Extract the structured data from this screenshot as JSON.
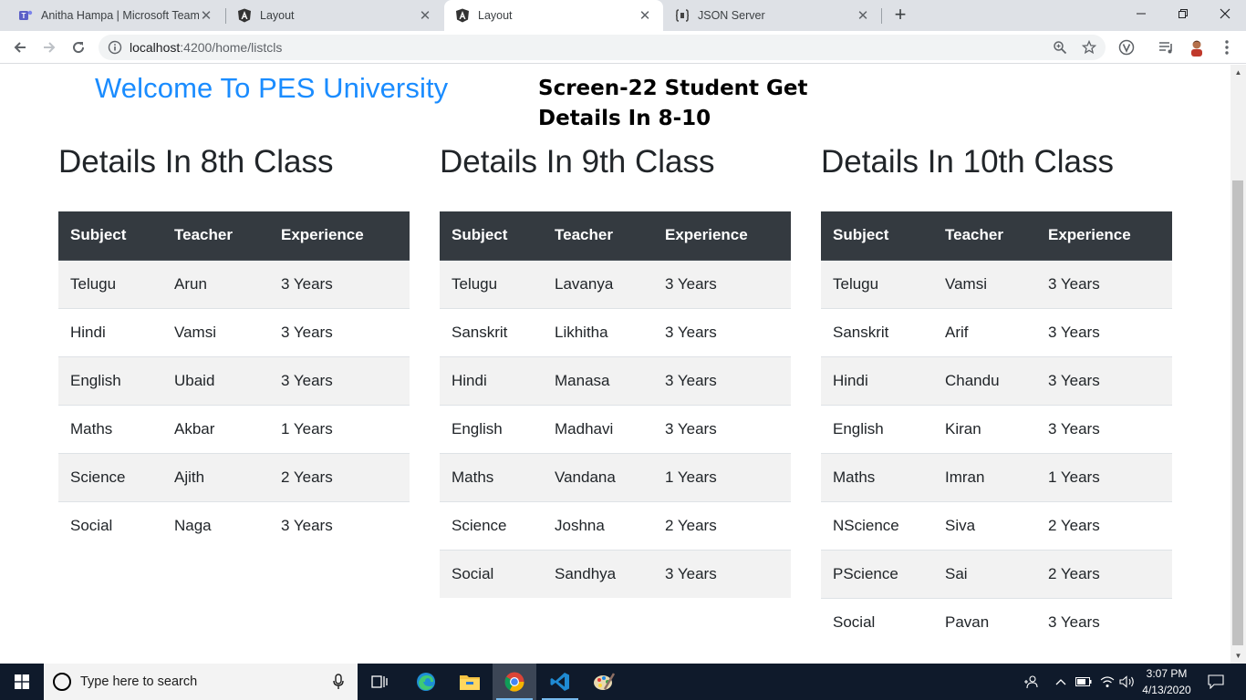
{
  "browser": {
    "tabs": [
      {
        "title": "Anitha Hampa | Microsoft Teams",
        "icon": "teams-icon"
      },
      {
        "title": "Layout",
        "icon": "angular-icon"
      },
      {
        "title": "Layout",
        "icon": "angular-icon"
      },
      {
        "title": "JSON Server",
        "icon": "json-server-icon"
      }
    ],
    "active_tab": 2,
    "url_host": "localhost",
    "url_path": ":4200/home/listcls"
  },
  "page": {
    "welcome": "Welcome To PES University",
    "screen_title": "Screen-22 Student Get Details In 8-10",
    "columns": [
      "Subject",
      "Teacher",
      "Experience"
    ],
    "classes": [
      {
        "heading": "Details In 8th Class",
        "rows": [
          [
            "Telugu",
            "Arun",
            "3 Years"
          ],
          [
            "Hindi",
            "Vamsi",
            "3 Years"
          ],
          [
            "English",
            "Ubaid",
            "3 Years"
          ],
          [
            "Maths",
            "Akbar",
            "1 Years"
          ],
          [
            "Science",
            "Ajith",
            "2 Years"
          ],
          [
            "Social",
            "Naga",
            "3 Years"
          ]
        ]
      },
      {
        "heading": "Details In 9th Class",
        "rows": [
          [
            "Telugu",
            "Lavanya",
            "3 Years"
          ],
          [
            "Sanskrit",
            "Likhitha",
            "3 Years"
          ],
          [
            "Hindi",
            "Manasa",
            "3 Years"
          ],
          [
            "English",
            "Madhavi",
            "3 Years"
          ],
          [
            "Maths",
            "Vandana",
            "1 Years"
          ],
          [
            "Science",
            "Joshna",
            "2 Years"
          ],
          [
            "Social",
            "Sandhya",
            "3 Years"
          ]
        ]
      },
      {
        "heading": "Details In 10th Class",
        "rows": [
          [
            "Telugu",
            "Vamsi",
            "3 Years"
          ],
          [
            "Sanskrit",
            "Arif",
            "3 Years"
          ],
          [
            "Hindi",
            "Chandu",
            "3 Years"
          ],
          [
            "English",
            "Kiran",
            "3 Years"
          ],
          [
            "Maths",
            "Imran",
            "1 Years"
          ],
          [
            "NScience",
            "Siva",
            "2 Years"
          ],
          [
            "PScience",
            "Sai",
            "2 Years"
          ],
          [
            "Social",
            "Pavan",
            "3 Years"
          ]
        ]
      }
    ]
  },
  "taskbar": {
    "search_placeholder": "Type here to search",
    "time": "3:07 PM",
    "date": "4/13/2020"
  },
  "colors": {
    "welcome": "#1a8cff",
    "table_header": "#343a40",
    "stripe": "#f2f2f2"
  }
}
